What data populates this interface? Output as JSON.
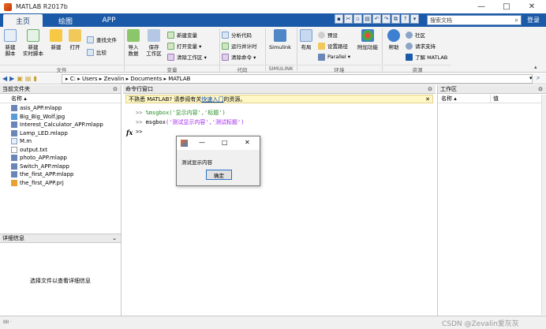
{
  "window": {
    "title": "MATLAB R2017b",
    "minimize": "—",
    "maximize": "□",
    "close": "✕"
  },
  "tabs": [
    {
      "label": "主页"
    },
    {
      "label": "绘图"
    },
    {
      "label": "APP"
    }
  ],
  "search": {
    "placeholder": "搜索文档"
  },
  "login": "登录",
  "ribbon": {
    "file_group": {
      "title": "文件",
      "new_script": "新建\n脚本",
      "new_live_script": "新建\n实时脚本",
      "new": "新建",
      "open": "打开",
      "find_files": "查找文件",
      "compare": "比较"
    },
    "variable_group": {
      "title": "变量",
      "import_data": "导入\n数据",
      "save_workspace": "保存\n工作区",
      "new_variable": "新建变量",
      "open_variable": "打开变量 ▾",
      "clear_workspace": "清除工作区 ▾"
    },
    "code_group": {
      "title": "代码",
      "analyze_code": "分析代码",
      "run_and_time": "运行并计时",
      "clear_commands": "清除命令 ▾"
    },
    "simulink_group": {
      "title": "SIMULINK",
      "simulink": "Simulink"
    },
    "env_group": {
      "title": "环境",
      "layout": "布局",
      "preferences": "预设",
      "set_path": "设置路径",
      "parallel": "Parallel ▾",
      "addons": "附加功能"
    },
    "resources_group": {
      "title": "资源",
      "help": "帮助",
      "community": "社区",
      "request_support": "请求支持",
      "learn_matlab": "了解 MATLAB"
    }
  },
  "address": {
    "path": "▸ C: ▸ Users ▸ Zevalin ▸ Documents ▸ MATLAB"
  },
  "current_folder": {
    "title": "当前文件夹",
    "column": "名称 ▴",
    "files": [
      "asis_APP.mlapp",
      "Big_Big_Wolf.jpg",
      "Interest_Calculator_APP.mlapp",
      "Lamp_LED.mlapp",
      "M.m",
      "output.txt",
      "photo_APP.mlapp",
      "Switch_APP.mlapp",
      "the_first_APP.mlapp",
      "the_first_APP.prj"
    ]
  },
  "details": {
    "title": "详细信息",
    "message": "选择文件以查看详细信息"
  },
  "command_window": {
    "title": "命令行窗口",
    "tip_prefix": "不熟悉 MATLAB? 请参阅有关",
    "tip_link": "快速入门",
    "tip_suffix": "的资源。",
    "prompt": ">>",
    "line1_func": "%msgbox",
    "line1_args": "('显示内容','标题')",
    "line2_func": "msgbox",
    "line2_args": "('测试显示内容','测试标题')",
    "fx": "fx"
  },
  "workspace": {
    "title": "工作区",
    "col_name": "名称 ▴",
    "col_value": "值"
  },
  "dialog": {
    "message": "测试显示内容",
    "ok": "确定",
    "minimize": "—",
    "maximize": "□",
    "close": "✕"
  },
  "status": {
    "left": "IIII ·",
    "watermark": "CSDN @Zevalin爱灰灰"
  }
}
